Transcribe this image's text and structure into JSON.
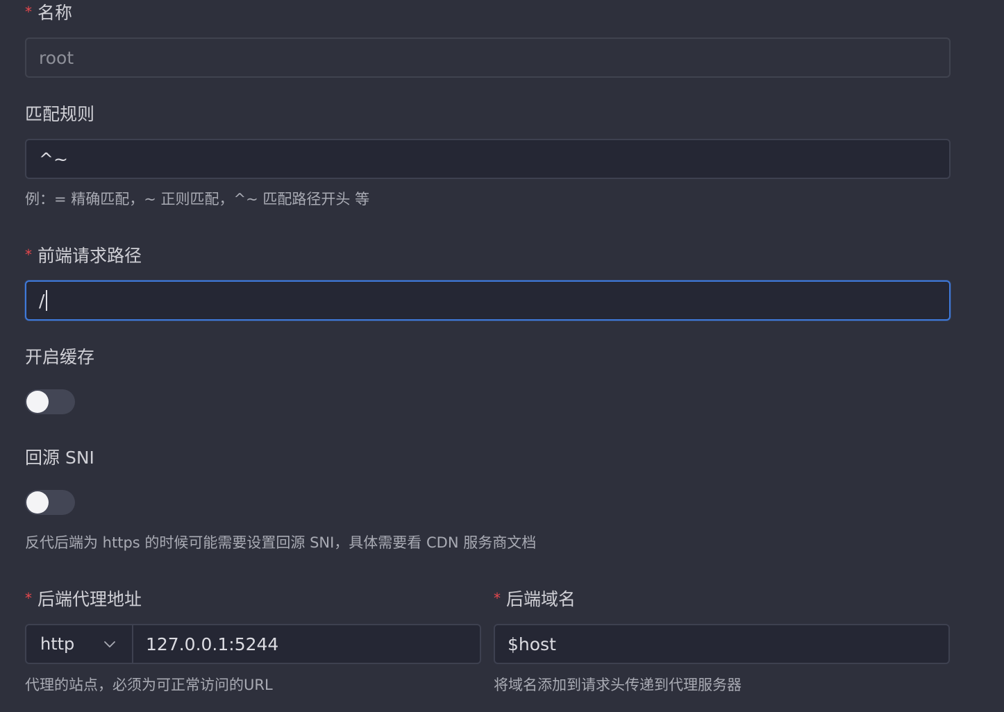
{
  "name_field": {
    "required_mark": "*",
    "label": "名称",
    "value": "root"
  },
  "match_rule": {
    "label": "匹配规则",
    "value": "^~",
    "hint": "例：= 精确匹配，~ 正则匹配，^~ 匹配路径开头 等"
  },
  "frontend_path": {
    "required_mark": "*",
    "label": "前端请求路径",
    "value": "/"
  },
  "cache": {
    "label": "开启缓存",
    "enabled": false
  },
  "origin_sni": {
    "label": "回源 SNI",
    "enabled": false,
    "hint": "反代后端为 https 的时候可能需要设置回源 SNI，具体需要看 CDN 服务商文档"
  },
  "backend_proxy": {
    "required_mark": "*",
    "label": "后端代理地址",
    "protocol": "http",
    "address": "127.0.0.1:5244",
    "hint": "代理的站点，必须为可正常访问的URL"
  },
  "backend_host": {
    "required_mark": "*",
    "label": "后端域名",
    "value": "$host",
    "hint": "将域名添加到请求头传递到代理服务器"
  },
  "colors": {
    "background": "#2e303c",
    "input_bg": "#252734",
    "focus_border": "#3f79d9",
    "required": "#e5484d"
  }
}
